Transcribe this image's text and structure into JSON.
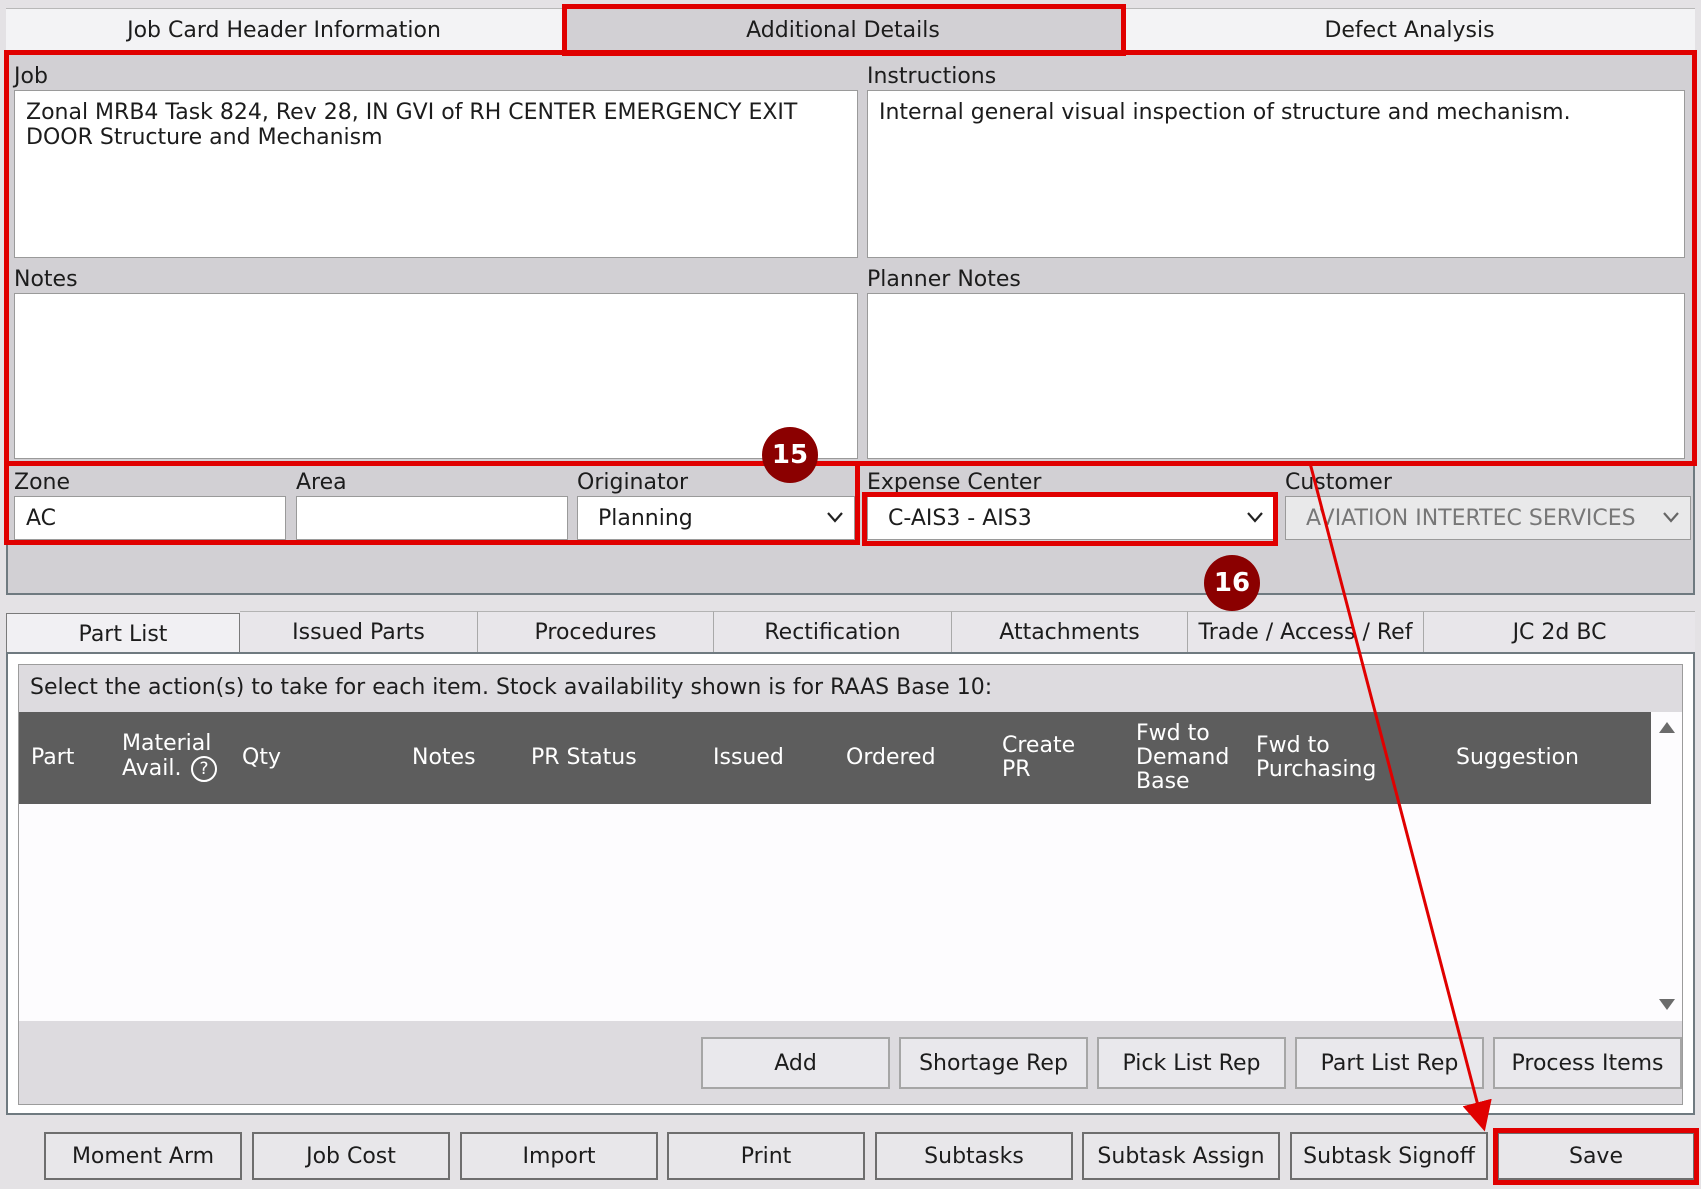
{
  "top_tabs": [
    {
      "label": "Job Card Header Information"
    },
    {
      "label": "Additional Details"
    },
    {
      "label": "Defect Analysis"
    }
  ],
  "job": {
    "label": "Job",
    "value": "Zonal MRB4 Task 824, Rev 28, IN GVI of RH CENTER EMERGENCY EXIT DOOR Structure and Mechanism"
  },
  "instructions": {
    "label": "Instructions",
    "value": "Internal general visual inspection of structure and mechanism."
  },
  "notes": {
    "label": "Notes",
    "value": ""
  },
  "planner_notes": {
    "label": "Planner Notes",
    "value": ""
  },
  "zone": {
    "label": "Zone",
    "value": "AC"
  },
  "area": {
    "label": "Area",
    "value": ""
  },
  "originator": {
    "label": "Originator",
    "value": "Planning"
  },
  "expense_center": {
    "label": "Expense Center",
    "value": "C-AIS3 - AIS3"
  },
  "customer": {
    "label": "Customer",
    "value": "AVIATION INTERTEC SERVICES"
  },
  "bottom_tabs": [
    {
      "label": "Part List"
    },
    {
      "label": "Issued Parts"
    },
    {
      "label": "Procedures"
    },
    {
      "label": "Rectification"
    },
    {
      "label": "Attachments"
    },
    {
      "label": "Trade / Access / Ref"
    },
    {
      "label": "JC 2d BC"
    }
  ],
  "part_list": {
    "instruction": "Select the action(s) to take for each item. Stock availability shown is for RAAS Base 10:",
    "columns": {
      "part": "Part",
      "material_avail_1": "Material",
      "material_avail_2": "Avail.",
      "help": "?",
      "qty": "Qty",
      "notes": "Notes",
      "pr_status": "PR Status",
      "issued": "Issued",
      "ordered": "Ordered",
      "create_pr_1": "Create",
      "create_pr_2": "PR",
      "fwd_demand_1": "Fwd to",
      "fwd_demand_2": "Demand",
      "fwd_demand_3": "Base",
      "fwd_purchasing_1": "Fwd to",
      "fwd_purchasing_2": "Purchasing",
      "suggestion": "Suggestion"
    },
    "rows": [],
    "actions": {
      "add": "Add",
      "shortage_rep": "Shortage Rep",
      "pick_list_rep": "Pick List Rep",
      "part_list_rep": "Part List Rep",
      "process_items": "Process Items"
    }
  },
  "footer_buttons": {
    "moment_arm": "Moment Arm",
    "job_cost": "Job Cost",
    "import": "Import",
    "print": "Print",
    "subtasks": "Subtasks",
    "subtask_assign": "Subtask Assign",
    "subtask_signoff": "Subtask Signoff",
    "save": "Save"
  },
  "annotations": {
    "badge_15": "15",
    "badge_16": "16",
    "highlight_color": "#e00000",
    "badge_color": "#8b0000"
  }
}
